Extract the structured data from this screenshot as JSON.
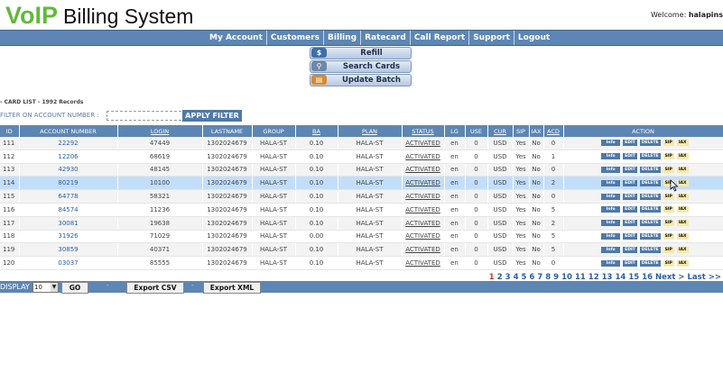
{
  "header": {
    "logo_voip": "VoIP",
    "logo_rest": "Billing System",
    "welcome_label": "Welcome:",
    "welcome_user": "halapins"
  },
  "topnav": [
    "My Account",
    "Customers",
    "Billing",
    "Ratecard",
    "Call Report",
    "Support",
    "Logout"
  ],
  "submenu": {
    "refill": "Refill",
    "search_cards": "Search Cards",
    "update_batch": "Update Batch"
  },
  "card_list_title": "- CARD LIST - 1992 Records",
  "filter": {
    "label": "FILTER ON ACCOUNT NUMBER :",
    "value": "",
    "button": "APPLY FILTER"
  },
  "table": {
    "columns": [
      "ID",
      "ACCOUNT NUMBER",
      "LOGIN",
      "LASTNAME",
      "GROUP",
      "BA",
      "PLAN",
      "STATUS",
      "LG",
      "USE",
      "CUR",
      "SIP",
      "IAX",
      "ACD",
      "ACTION"
    ],
    "action_labels": {
      "info": "Info",
      "edit": "EDIT",
      "delete": "DELETE",
      "sip": "SIP",
      "iax": "IAX"
    },
    "rows": [
      {
        "id": "111",
        "account": "22292",
        "login": "47449",
        "lastname": "1302024679",
        "group": "HALA-ST",
        "ba": "0.10",
        "plan": "HALA-ST",
        "status": "ACTIVATED",
        "lg": "en",
        "use": "0",
        "cur": "USD",
        "sip": "Yes",
        "iax": "No",
        "acd": "0"
      },
      {
        "id": "112",
        "account": "12206",
        "login": "68619",
        "lastname": "1302024679",
        "group": "HALA-ST",
        "ba": "0.10",
        "plan": "HALA-ST",
        "status": "ACTIVATED",
        "lg": "en",
        "use": "0",
        "cur": "USD",
        "sip": "Yes",
        "iax": "No",
        "acd": "1"
      },
      {
        "id": "113",
        "account": "42930",
        "login": "48145",
        "lastname": "1302024679",
        "group": "HALA-ST",
        "ba": "0.10",
        "plan": "HALA-ST",
        "status": "ACTIVATED",
        "lg": "en",
        "use": "0",
        "cur": "USD",
        "sip": "Yes",
        "iax": "No",
        "acd": "0"
      },
      {
        "id": "114",
        "account": "80219",
        "login": "10100",
        "lastname": "1302024679",
        "group": "HALA-ST",
        "ba": "0.10",
        "plan": "HALA-ST",
        "status": "ACTIVATED",
        "lg": "en",
        "use": "0",
        "cur": "USD",
        "sip": "Yes",
        "iax": "No",
        "acd": "2"
      },
      {
        "id": "115",
        "account": "64778",
        "login": "58321",
        "lastname": "1302024679",
        "group": "HALA-ST",
        "ba": "0.10",
        "plan": "HALA-ST",
        "status": "ACTIVATED",
        "lg": "en",
        "use": "0",
        "cur": "USD",
        "sip": "Yes",
        "iax": "No",
        "acd": "0"
      },
      {
        "id": "116",
        "account": "84574",
        "login": "11236",
        "lastname": "1302024679",
        "group": "HALA-ST",
        "ba": "0.10",
        "plan": "HALA-ST",
        "status": "ACTIVATED",
        "lg": "en",
        "use": "0",
        "cur": "USD",
        "sip": "Yes",
        "iax": "No",
        "acd": "5"
      },
      {
        "id": "117",
        "account": "30081",
        "login": "19638",
        "lastname": "1302024679",
        "group": "HALA-ST",
        "ba": "0.10",
        "plan": "HALA-ST",
        "status": "ACTIVATED",
        "lg": "en",
        "use": "0",
        "cur": "USD",
        "sip": "Yes",
        "iax": "No",
        "acd": "2"
      },
      {
        "id": "118",
        "account": "31926",
        "login": "71029",
        "lastname": "1302024679",
        "group": "HALA-ST",
        "ba": "0.00",
        "plan": "HALA-ST",
        "status": "ACTIVATED",
        "lg": "en",
        "use": "0",
        "cur": "USD",
        "sip": "Yes",
        "iax": "No",
        "acd": "5"
      },
      {
        "id": "119",
        "account": "30859",
        "login": "40371",
        "lastname": "1302024679",
        "group": "HALA-ST",
        "ba": "0.10",
        "plan": "HALA-ST",
        "status": "ACTIVATED",
        "lg": "en",
        "use": "0",
        "cur": "USD",
        "sip": "Yes",
        "iax": "No",
        "acd": "5"
      },
      {
        "id": "120",
        "account": "03037",
        "login": "85555",
        "lastname": "1302024679",
        "group": "HALA-ST",
        "ba": "0.10",
        "plan": "HALA-ST",
        "status": "ACTIVATED",
        "lg": "en",
        "use": "0",
        "cur": "USD",
        "sip": "Yes",
        "iax": "No",
        "acd": "0"
      }
    ],
    "highlighted_row": 3
  },
  "pagination": {
    "pages": [
      "1",
      "2",
      "3",
      "4",
      "5",
      "6",
      "7",
      "8",
      "9",
      "10",
      "11",
      "12",
      "13",
      "14",
      "15",
      "16"
    ],
    "current": "1",
    "next": "Next >",
    "last": "Last >>"
  },
  "bottom": {
    "display_label": "DISPLAY",
    "display_value": "10",
    "go": "GO",
    "export_csv": "Export CSV",
    "export_xml": "Export XML"
  },
  "colors": {
    "nav_blue": "#5d86b4",
    "logo_green": "#63b93a",
    "row_highlight": "#c3defa",
    "link_blue": "#2a5fa6",
    "current_page": "#d23a2a"
  }
}
